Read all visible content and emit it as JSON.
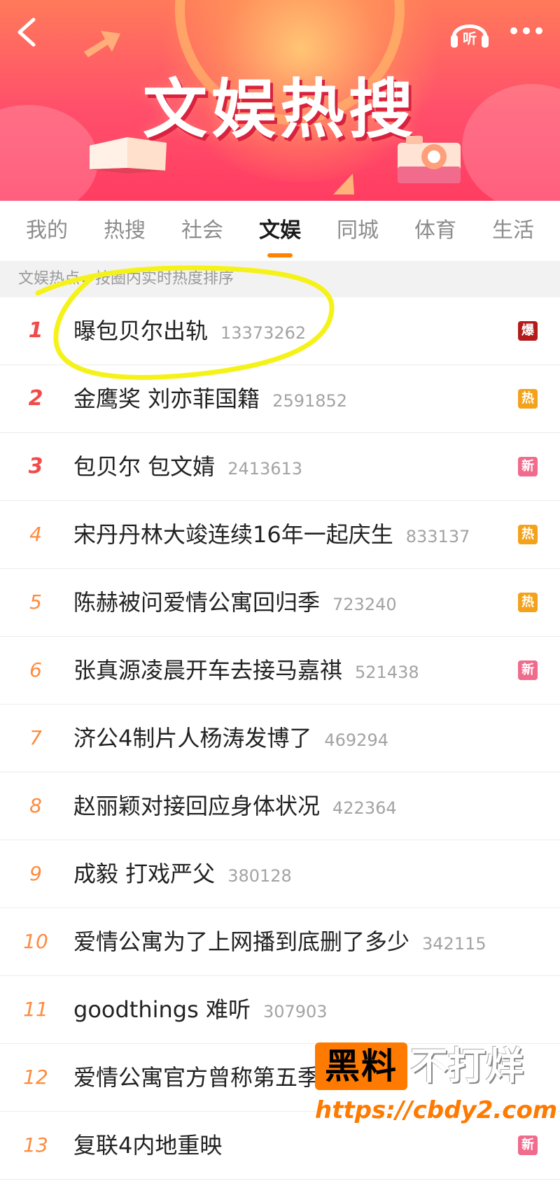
{
  "header": {
    "banner_title": "文娱热搜",
    "back_icon": "back-chevron-icon",
    "listen_label": "听",
    "more_icon": "more-dots-icon"
  },
  "tabs": [
    {
      "label": "我的",
      "active": false
    },
    {
      "label": "热搜",
      "active": false
    },
    {
      "label": "社会",
      "active": false
    },
    {
      "label": "文娱",
      "active": true
    },
    {
      "label": "同城",
      "active": false
    },
    {
      "label": "体育",
      "active": false
    },
    {
      "label": "生活",
      "active": false
    }
  ],
  "subheader": "文娱热点，按圈内实时热度排序",
  "list": [
    {
      "rank": "1",
      "title": "曝包贝尔出轨",
      "count": "13373262",
      "badge": "爆"
    },
    {
      "rank": "2",
      "title": "金鹰奖 刘亦菲国籍",
      "count": "2591852",
      "badge": "热"
    },
    {
      "rank": "3",
      "title": "包贝尔 包文婧",
      "count": "2413613",
      "badge": "新"
    },
    {
      "rank": "4",
      "title": "宋丹丹林大竣连续16年一起庆生",
      "count": "833137",
      "badge": "热"
    },
    {
      "rank": "5",
      "title": "陈赫被问爱情公寓回归季",
      "count": "723240",
      "badge": "热"
    },
    {
      "rank": "6",
      "title": "张真源凌晨开车去接马嘉祺",
      "count": "521438",
      "badge": "新"
    },
    {
      "rank": "7",
      "title": "济公4制片人杨涛发博了",
      "count": "469294",
      "badge": ""
    },
    {
      "rank": "8",
      "title": "赵丽颖对接回应身体状况",
      "count": "422364",
      "badge": ""
    },
    {
      "rank": "9",
      "title": "成毅 打戏严父",
      "count": "380128",
      "badge": ""
    },
    {
      "rank": "10",
      "title": "爱情公寓为了上网播到底删了多少",
      "count": "342115",
      "badge": ""
    },
    {
      "rank": "11",
      "title": "goodthings 难听",
      "count": "307903",
      "badge": ""
    },
    {
      "rank": "12",
      "title": "爱情公寓官方曾称第五季",
      "count": "",
      "badge": ""
    },
    {
      "rank": "13",
      "title": "复联4内地重映",
      "count": "",
      "badge": "新"
    }
  ],
  "watermark": {
    "box_text": "黑料",
    "text": "不打烊",
    "url": "https://cbdy2.com"
  },
  "colors": {
    "accent": "#ff8200",
    "badge_bao": "#b31b1b",
    "badge_re": "#f3a21b",
    "badge_xin": "#f06b8c",
    "annotation": "#f5f21a"
  }
}
